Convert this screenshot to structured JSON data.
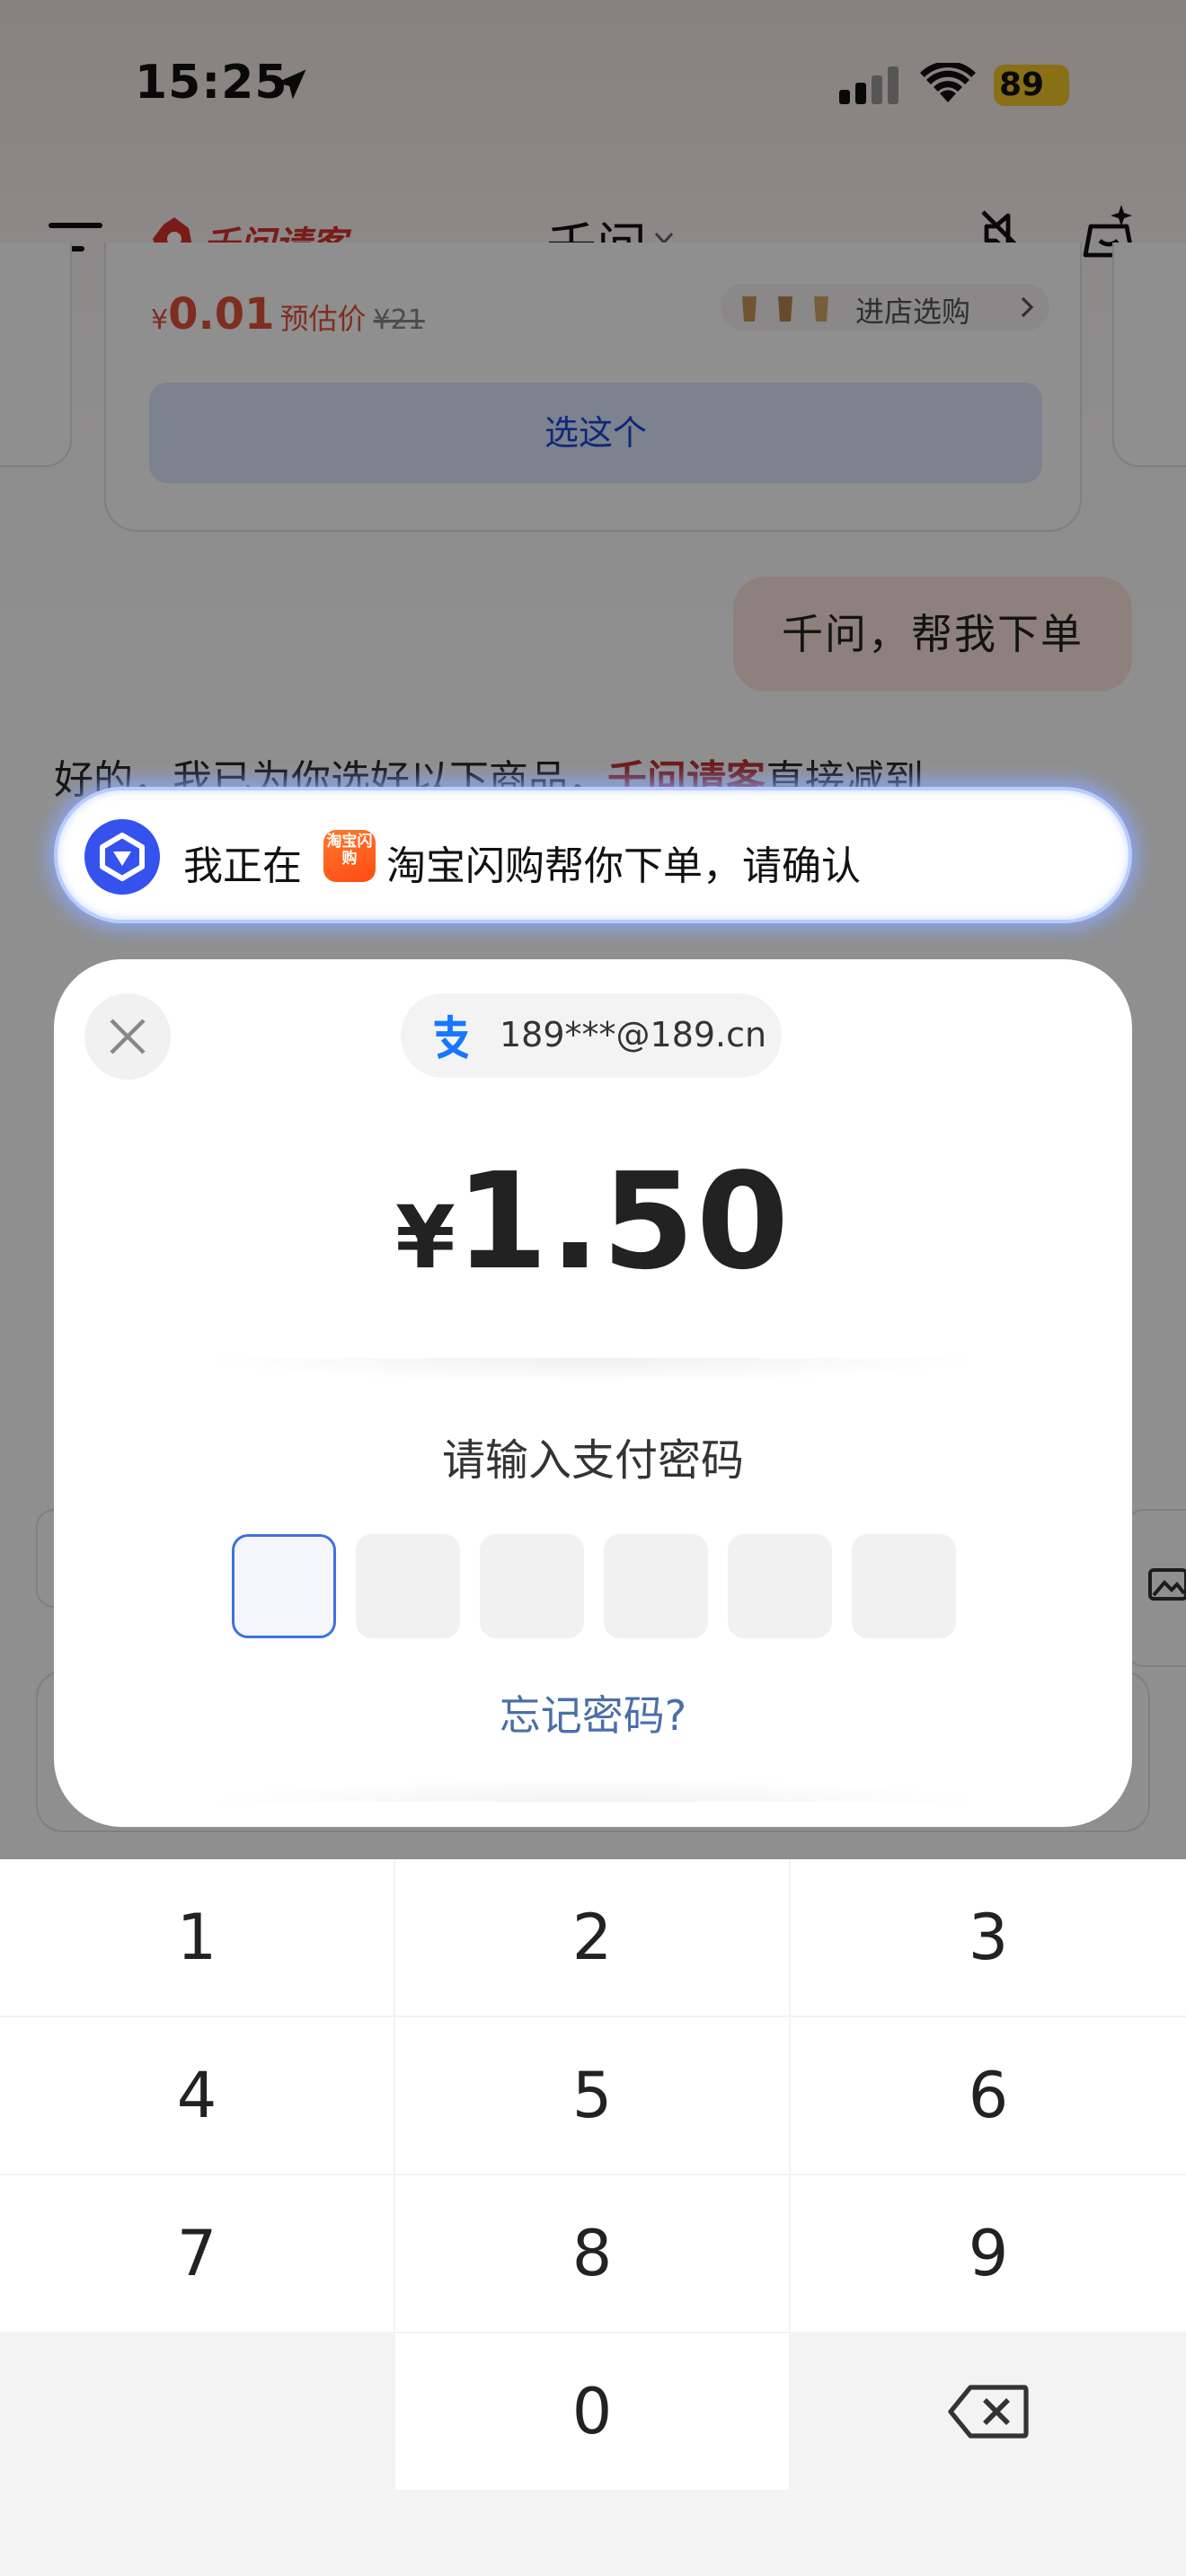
{
  "status_bar": {
    "time": "15:25",
    "battery": "89",
    "icons": [
      "location-arrow-icon",
      "cellular-signal-icon",
      "wifi-icon",
      "battery-charging-icon"
    ]
  },
  "header": {
    "brand": "千问请客",
    "title": "千问",
    "icons": [
      "menu-icon",
      "mute-icon",
      "sparkle-icon"
    ]
  },
  "product_card": {
    "price_currency": "¥",
    "price": "0.01",
    "estimate_label": "预估价",
    "original_price": "¥21",
    "shop_link": "进店选购",
    "select_button": "选这个"
  },
  "chat": {
    "user_message": "千问，帮我下单",
    "reply_prefix": "好的，我已为你选好以下商品，",
    "reply_brand": "千问请客",
    "reply_suffix": "直接减到"
  },
  "agent_banner": {
    "text_before": "我正在",
    "app_icon_text": "淘宝闪购",
    "text_after": "淘宝闪购帮你下单，请确认"
  },
  "payment": {
    "account": "189***@189.cn",
    "currency": "¥",
    "amount": "1.50",
    "prompt": "请输入支付密码",
    "password_length": 6,
    "entered_digits": 0,
    "forgot_link": "忘记密码?"
  },
  "keypad": {
    "keys": [
      "1",
      "2",
      "3",
      "4",
      "5",
      "6",
      "7",
      "8",
      "9",
      "0"
    ],
    "delete_icon": "backspace-icon"
  },
  "colors": {
    "accent_blue": "#3d72e0",
    "brand_red": "#d8322a",
    "agent_blue": "#3552ee",
    "link_blue": "#4a6fa8"
  }
}
